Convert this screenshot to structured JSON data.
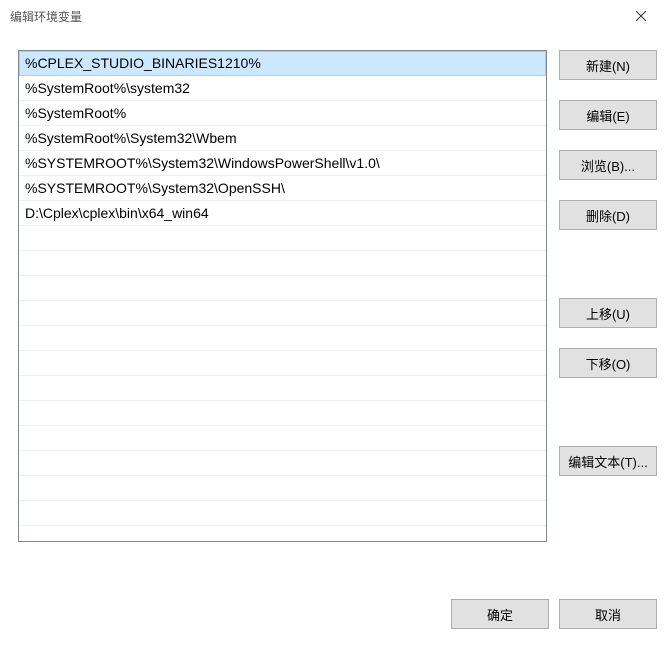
{
  "window": {
    "title": "编辑环境变量"
  },
  "list": {
    "items": [
      "%CPLEX_STUDIO_BINARIES1210%",
      "%SystemRoot%\\system32",
      "%SystemRoot%",
      "%SystemRoot%\\System32\\Wbem",
      "%SYSTEMROOT%\\System32\\WindowsPowerShell\\v1.0\\",
      "%SYSTEMROOT%\\System32\\OpenSSH\\",
      "D:\\Cplex\\cplex\\bin\\x64_win64"
    ],
    "selected_index": 0
  },
  "buttons": {
    "new": "新建(N)",
    "edit": "编辑(E)",
    "browse": "浏览(B)...",
    "delete": "删除(D)",
    "move_up": "上移(U)",
    "move_down": "下移(O)",
    "edit_text": "编辑文本(T)...",
    "ok": "确定",
    "cancel": "取消"
  }
}
